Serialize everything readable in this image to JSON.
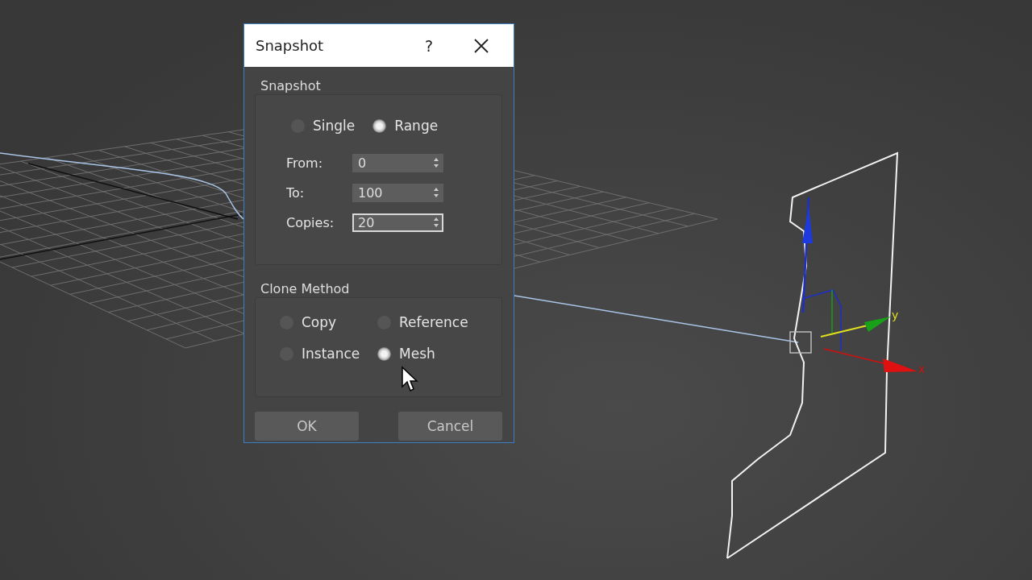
{
  "window": {
    "title": "Snapshot",
    "help": "?"
  },
  "snapshot_group": {
    "label": "Snapshot",
    "modes": [
      {
        "label": "Single",
        "selected": false
      },
      {
        "label": "Range",
        "selected": true
      }
    ],
    "fields": [
      {
        "label": "From:",
        "value": "0",
        "focused": false
      },
      {
        "label": "To:",
        "value": "100",
        "focused": false
      },
      {
        "label": "Copies:",
        "value": "20",
        "focused": true
      }
    ]
  },
  "clone_method": {
    "label": "Clone Method",
    "options": [
      {
        "label": "Copy",
        "selected": false
      },
      {
        "label": "Reference",
        "selected": false
      },
      {
        "label": "Instance",
        "selected": false
      },
      {
        "label": "Mesh",
        "selected": true
      }
    ]
  },
  "buttons": [
    {
      "label": "OK"
    },
    {
      "label": "Cancel"
    }
  ],
  "viewport": {
    "gizmo_labels": [
      "y",
      "x"
    ]
  }
}
